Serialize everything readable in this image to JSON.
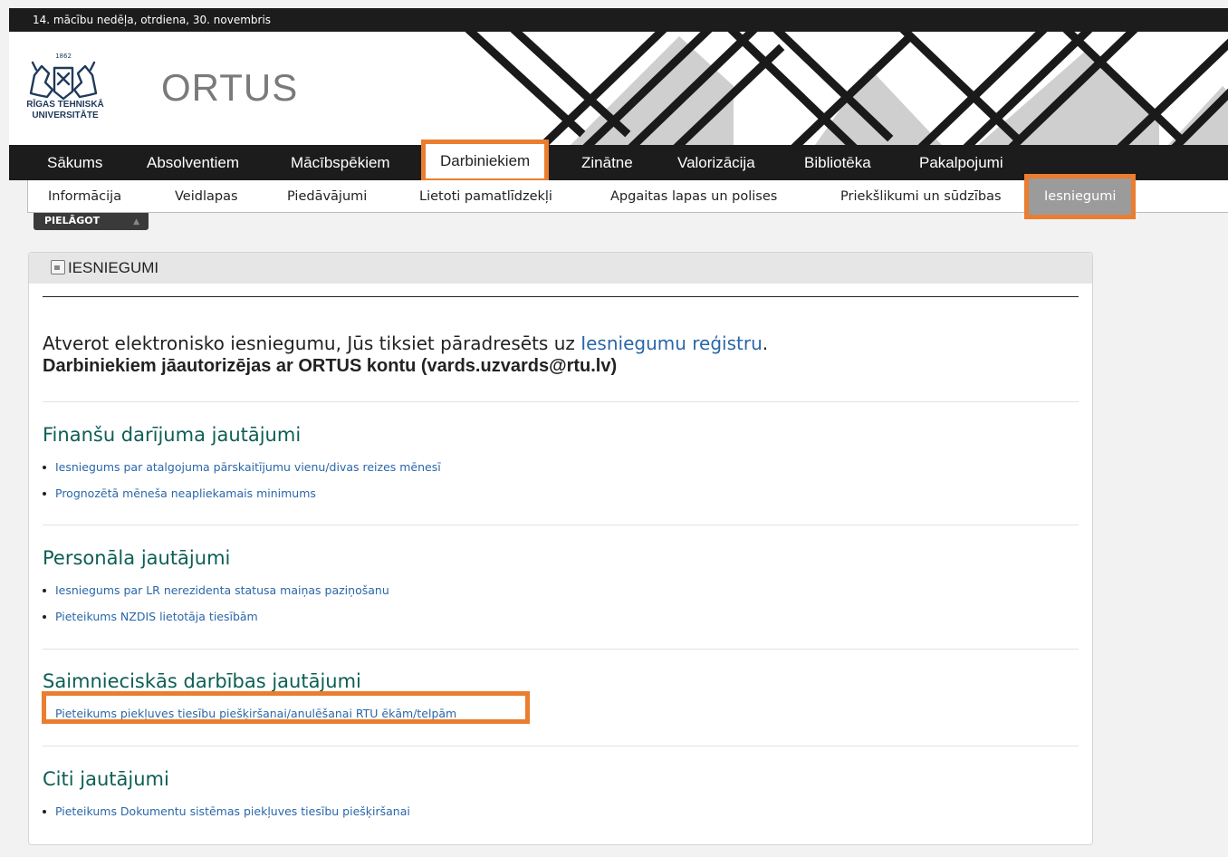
{
  "topbar": {
    "date_text": "14. mācību nedēļa, otrdiena, 30. novembris"
  },
  "header": {
    "logo_year": "1862",
    "logo_caption_line1": "RĪGAS TEHNISKĀ",
    "logo_caption_line2": "UNIVERSITĀTE",
    "portal_name": "ORTUS"
  },
  "main_nav": {
    "items": [
      {
        "label": "Sākums"
      },
      {
        "label": "Absolventiem"
      },
      {
        "label": "Mācībspēkiem"
      },
      {
        "label": "Darbiniekiem",
        "active": true
      },
      {
        "label": "Zinātne"
      },
      {
        "label": "Valorizācija"
      },
      {
        "label": "Bibliotēka"
      },
      {
        "label": "Pakalpojumi"
      }
    ]
  },
  "sub_nav": {
    "items": [
      {
        "label": "Informācija"
      },
      {
        "label": "Veidlapas"
      },
      {
        "label": "Piedāvājumi"
      },
      {
        "label": "Lietoti pamatlīdzekļi"
      },
      {
        "label": "Apgaitas lapas un polises"
      },
      {
        "label": "Priekšlikumi un sūdzības"
      },
      {
        "label": "Iesniegumi",
        "active": true
      }
    ]
  },
  "customize_tab": {
    "label": "PIELĀGOT"
  },
  "panel": {
    "title": "IESNIEGUMI",
    "intro_prefix": "Atverot elektronisko iesniegumu, Jūs tiksiet pāradresēts uz ",
    "intro_link": "Iesniegumu reģistru",
    "intro_suffix": ".",
    "intro_bold": "Darbiniekiem jāautorizējas ar ORTUS kontu (vards.uzvards@rtu.lv)",
    "sections": [
      {
        "title": "Finanšu darījuma jautājumi",
        "links": [
          "Iesniegums par atalgojuma pārskaitījumu vienu/divas reizes mēnesī",
          "Prognozētā mēneša neapliekamais minimums"
        ]
      },
      {
        "title": "Personāla jautājumi",
        "links": [
          "Iesniegums par LR nerezidenta statusa maiņas paziņošanu",
          "Pieteikums NZDIS lietotāja tiesībām"
        ]
      },
      {
        "title": "Saimnieciskās darbības jautājumi",
        "links": [
          "Pieteikums piekļuves tiesību piešķiršanai/anulēšanai RTU ēkām/telpām"
        ]
      },
      {
        "title": "Citi jautājumi",
        "links": [
          "Pieteikums Dokumentu sistēmas piekļuves tiesību piešķiršanai"
        ]
      }
    ]
  },
  "colors": {
    "highlight": "#ea7d30",
    "heading_teal": "#0d5e55",
    "link_blue": "#2a67a8",
    "nav_dark": "#1c1c1c"
  }
}
